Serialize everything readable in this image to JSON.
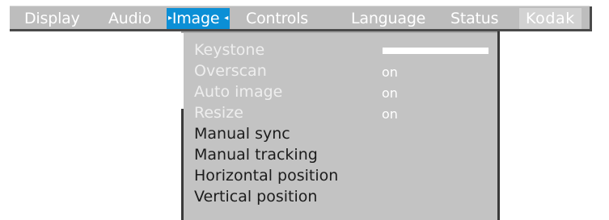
{
  "menubar": {
    "items": [
      {
        "label": "Display"
      },
      {
        "label": "Audio"
      },
      {
        "label": "Image",
        "marker_left": "▸",
        "marker_right": "◂"
      },
      {
        "label": "Controls"
      },
      {
        "label": "Language"
      },
      {
        "label": "Status"
      },
      {
        "label": "Kodak"
      }
    ],
    "active_index": 2
  },
  "image_menu": {
    "keystone": {
      "label": "Keystone",
      "level": 1.0
    },
    "overscan": {
      "label": "Overscan",
      "value": "on"
    },
    "auto_image": {
      "label": "Auto image",
      "value": "on"
    },
    "resize": {
      "label": "Resize",
      "value": "on"
    },
    "manual_sync": {
      "label": "Manual sync"
    },
    "manual_tracking": {
      "label": "Manual tracking"
    },
    "horizontal_position": {
      "label": "Horizontal position"
    },
    "vertical_position": {
      "label": "Vertical position"
    }
  },
  "colors": {
    "menubar_bg": "#bdbdbd",
    "active_highlight": "#0b8fd6",
    "panel_bg": "#c3c3c3",
    "disabled_text": "#eeeeee",
    "enabled_text": "#1c1c1c"
  }
}
